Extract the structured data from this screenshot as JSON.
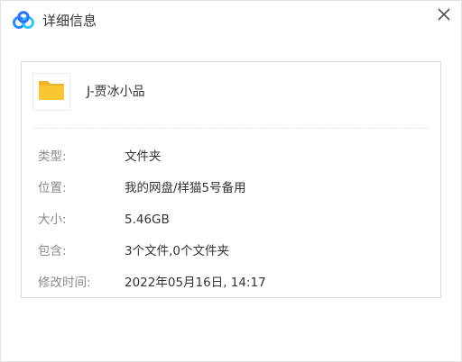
{
  "window": {
    "title": "详细信息",
    "logo_icon": "cloud-logo-icon",
    "close_icon": "close-icon"
  },
  "file": {
    "name": "J-贾冰小品",
    "icon": "folder-icon"
  },
  "details": [
    {
      "label": "类型:",
      "value": "文件夹"
    },
    {
      "label": "位置:",
      "value": "我的网盘/样猫5号备用"
    },
    {
      "label": "大小:",
      "value": "5.46GB"
    },
    {
      "label": "包含:",
      "value": "3个文件,0个文件夹"
    },
    {
      "label": "修改时间:",
      "value": "2022年05月16日, 14:17"
    }
  ],
  "colors": {
    "logo_blue": "#2f8cff",
    "logo_cyan": "#39c6f0",
    "folder_yellow": "#f9c634",
    "folder_tab": "#eeb52a"
  }
}
